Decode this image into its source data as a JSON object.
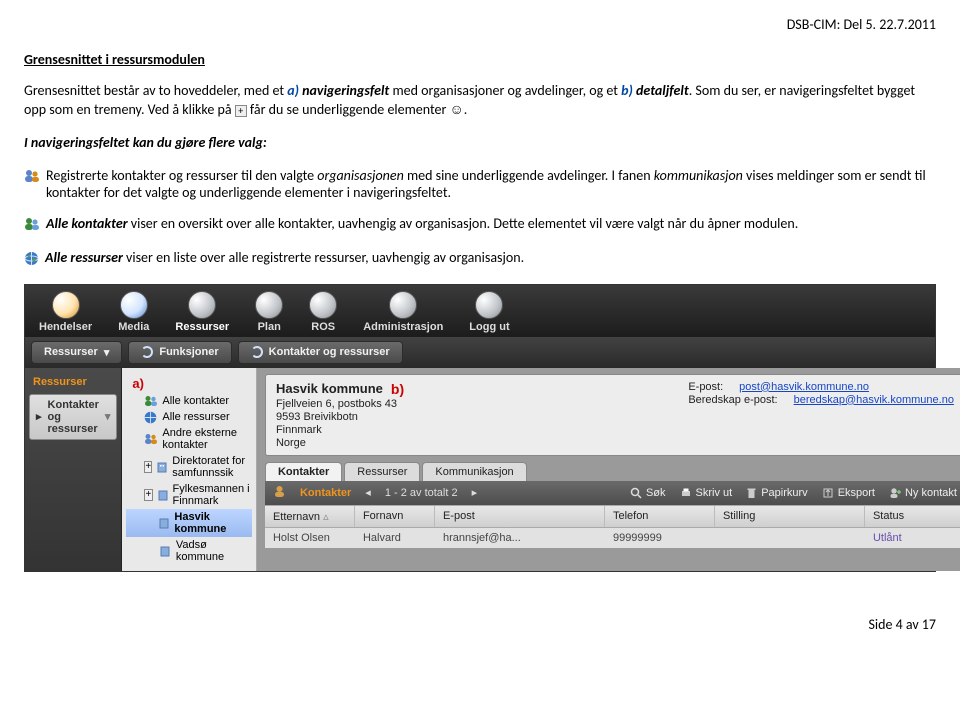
{
  "header": {
    "doc_id": "DSB-CIM: Del 5. 22.7.2011"
  },
  "heading": "Grensesnittet i ressursmodulen",
  "p1": {
    "t1": "Grensesnittet består av to hoveddeler, med et ",
    "a": "a) ",
    "a_em": "navigeringsfelt",
    "t2": " med organisasjoner og avdelinger, og et ",
    "b": "b) ",
    "b_em": "detaljfelt",
    "t3": ". Som du ser, er navigeringsfeltet bygget opp som en tremeny. Ved å klikke på ",
    "t4": " får du se underliggende elementer ☺."
  },
  "p2_lead": "I navigeringsfeltet kan du gjøre flere valg:",
  "p3": {
    "t1": "Registrerte kontakter og ressurser til den valgte ",
    "em1": "organisasjonen",
    "t2": " med sine underliggende avdelinger.  I fanen ",
    "em2": "kommunikasjon",
    "t3": " vises meldinger som er sendt til kontakter for det valgte og underliggende elementer i navigeringsfeltet."
  },
  "p4": {
    "em": "Alle kontakter",
    "t": " viser en oversikt over alle kontakter, uavhengig av organisasjon. Dette elementet vil være valgt når du åpner modulen."
  },
  "p5": {
    "em": "Alle ressurser",
    "t": " viser en liste over alle registrerte ressurser, uavhengig av organisasjon."
  },
  "app": {
    "topmenu": [
      {
        "label": "Hendelser",
        "cls": "warn"
      },
      {
        "label": "Media",
        "cls": "accent"
      },
      {
        "label": "Ressurser",
        "cls": "active"
      },
      {
        "label": "Plan",
        "cls": ""
      },
      {
        "label": "ROS",
        "cls": ""
      },
      {
        "label": "Administrasjon",
        "cls": ""
      },
      {
        "label": "Logg ut",
        "cls": ""
      }
    ],
    "subrow": {
      "a": "Ressurser",
      "b": "Funksjoner",
      "c": "Kontakter og ressurser"
    },
    "sidebar": {
      "label": "Ressurser",
      "selected": "Kontakter og ressurser"
    },
    "tree": {
      "annot_a": "a)",
      "items": [
        {
          "label": "Alle kontakter",
          "icon": "people"
        },
        {
          "label": "Alle ressurser",
          "icon": "globe"
        },
        {
          "label": "Andre eksterne kontakter",
          "icon": "people"
        },
        {
          "label": "Direktoratet for samfunnssik",
          "icon": "build",
          "expand": "+"
        },
        {
          "label": "Fylkesmannen i Finnmark",
          "icon": "build",
          "expand": "+"
        },
        {
          "label": "Hasvik kommune",
          "icon": "build",
          "sel": true
        },
        {
          "label": "Vadsø kommune",
          "icon": "build"
        }
      ]
    },
    "detail": {
      "title": "Hasvik kommune",
      "annot_b": "b)",
      "addr": [
        "Fjellveien 6, postboks 43",
        "9593 Breivikbotn",
        "Finnmark",
        "Norge"
      ],
      "right": [
        {
          "k": "E-post:",
          "v": "post@hasvik.kommune.no"
        },
        {
          "k": "Beredskap e-post:",
          "v": "beredskap@hasvik.kommune.no"
        }
      ],
      "tabs": [
        "Kontakter",
        "Ressurser",
        "Kommunikasjon"
      ],
      "toolbar": {
        "title": "Kontakter",
        "nav": "1 - 2 av totalt 2",
        "actions": [
          "Søk",
          "Skriv ut",
          "Papirkurv",
          "Eksport",
          "Ny kontakt"
        ]
      },
      "cols": [
        "Etternavn",
        "Fornavn",
        "E-post",
        "Telefon",
        "Stilling",
        "Status"
      ],
      "row": {
        "etternavn": "Holst Olsen",
        "fornavn": "Halvard",
        "epost": "hrannsjef@ha...",
        "telefon": "99999999",
        "stilling": "",
        "status": "Utlånt"
      }
    }
  },
  "footer": "Side 4 av 17"
}
